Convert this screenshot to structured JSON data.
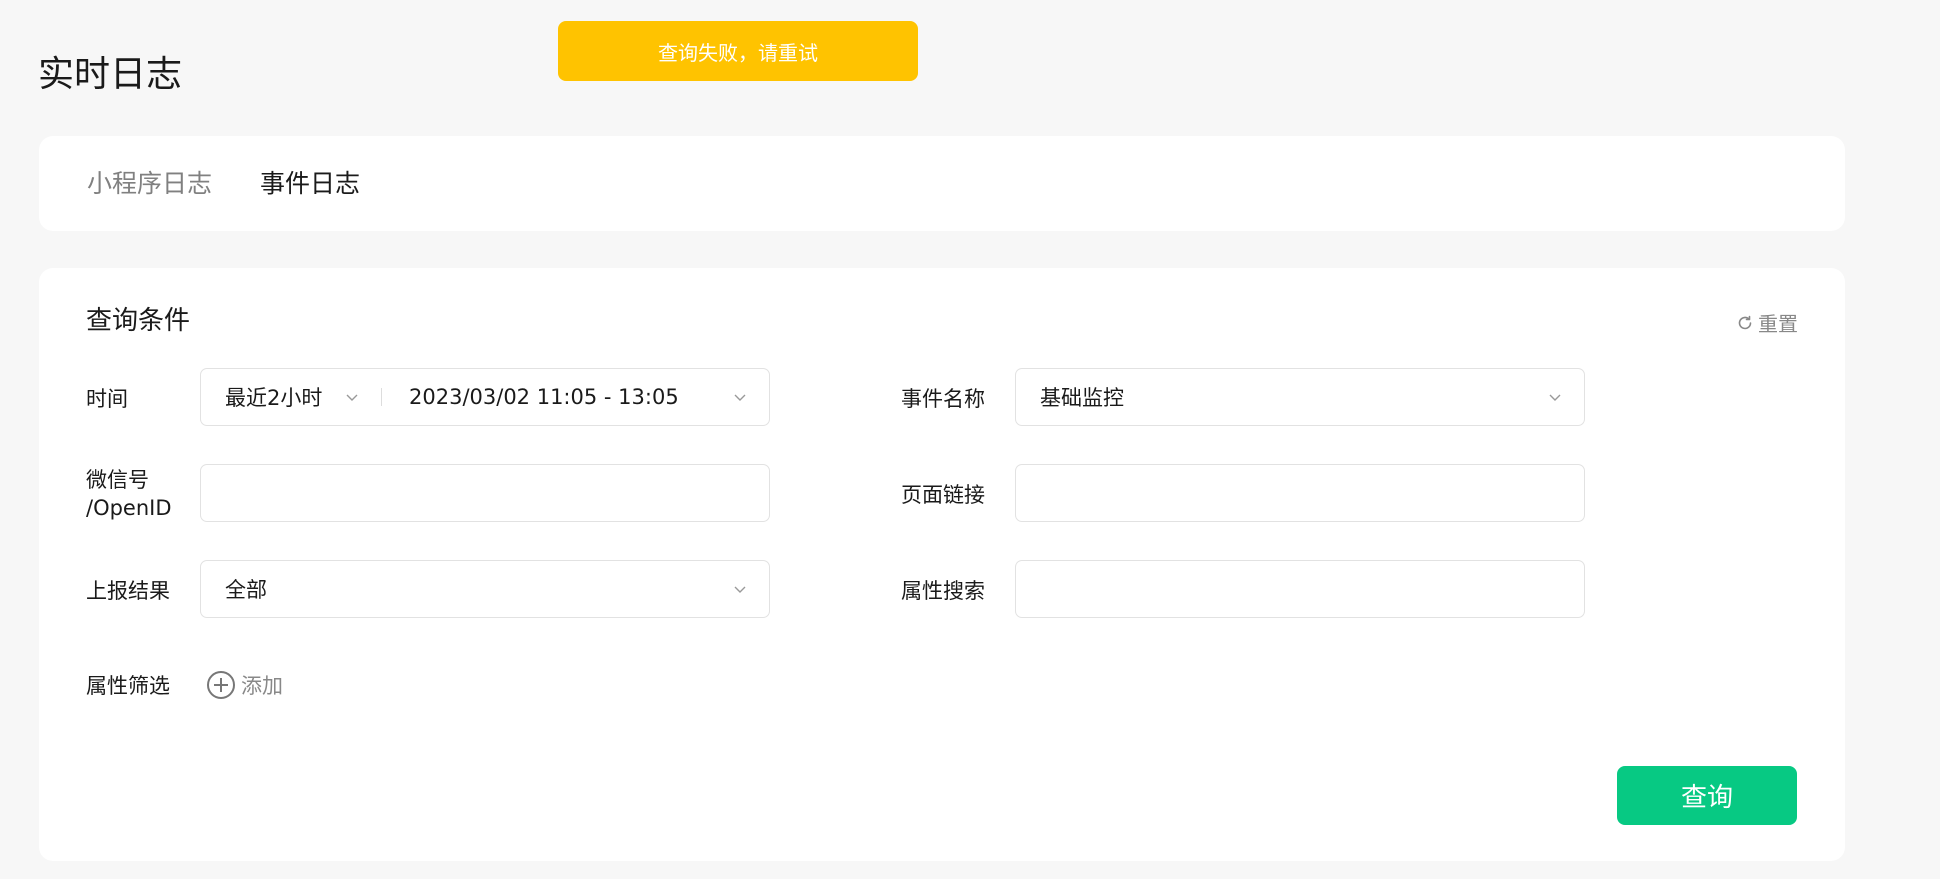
{
  "toast": {
    "message": "查询失败，请重试",
    "color": "#ffc300"
  },
  "page": {
    "title": "实时日志"
  },
  "tabs": [
    {
      "label": "小程序日志",
      "active": false
    },
    {
      "label": "事件日志",
      "active": true
    }
  ],
  "query": {
    "section_title": "查询条件",
    "reset_label": "重置",
    "time": {
      "label": "时间",
      "preset": "最近2小时",
      "range": "2023/03/02 11:05 - 13:05"
    },
    "event_name": {
      "label": "事件名称",
      "value": "基础监控"
    },
    "wechat": {
      "label_line1": "微信号",
      "label_line2": "/OpenID",
      "value": ""
    },
    "page_link": {
      "label": "页面链接",
      "value": ""
    },
    "report_result": {
      "label": "上报结果",
      "value": "全部"
    },
    "attr_search": {
      "label": "属性搜索",
      "value": ""
    },
    "attr_filter": {
      "label": "属性筛选",
      "add_label": "添加"
    },
    "submit_label": "查询",
    "accent_color": "#07c983"
  }
}
